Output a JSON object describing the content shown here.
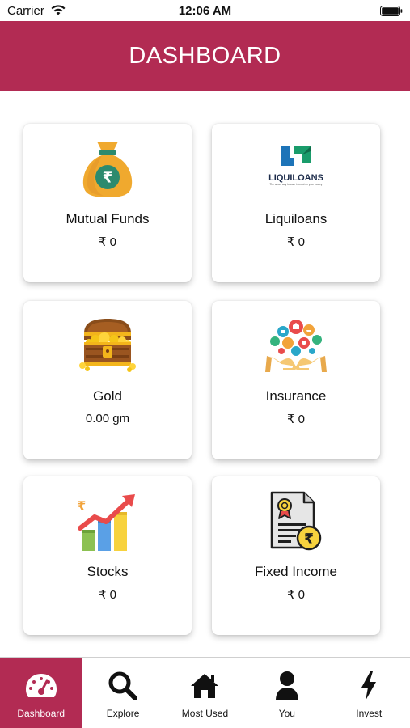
{
  "status_bar": {
    "carrier": "Carrier",
    "time": "12:06 AM"
  },
  "header": {
    "title": "DASHBOARD",
    "color": "#b22b53"
  },
  "cards": [
    {
      "label": "Mutual Funds",
      "value": "₹ 0",
      "icon": "money-bag-icon"
    },
    {
      "label": "Liquiloans",
      "value": "₹ 0",
      "icon": "liquiloans-logo",
      "logo_text": "LIQUILOANS",
      "logo_tagline": "The smart way to earn interest on your money"
    },
    {
      "label": "Gold",
      "value": "0.00 gm",
      "icon": "treasure-chest-icon"
    },
    {
      "label": "Insurance",
      "value": "₹ 0",
      "icon": "insurance-hands-icon"
    },
    {
      "label": "Stocks",
      "value": "₹ 0",
      "icon": "stocks-chart-icon"
    },
    {
      "label": "Fixed Income",
      "value": "₹ 0",
      "icon": "certificate-icon"
    }
  ],
  "bottom_nav": [
    {
      "label": "Dashboard",
      "icon": "speedometer-icon",
      "active": true
    },
    {
      "label": "Explore",
      "icon": "search-icon",
      "active": false
    },
    {
      "label": "Most Used",
      "icon": "home-icon",
      "active": false
    },
    {
      "label": "You",
      "icon": "user-icon",
      "active": false
    },
    {
      "label": "Invest",
      "icon": "lightning-icon",
      "active": false
    }
  ]
}
